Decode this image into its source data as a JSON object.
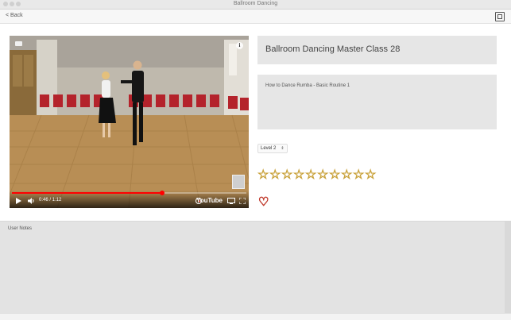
{
  "window": {
    "title": "Ballroom Dancing"
  },
  "toolbar": {
    "back_label": "< Back",
    "fullscreen_icon": "fullscreen-icon"
  },
  "video": {
    "time": "0:46 / 1:12",
    "progress": 0.64,
    "brand": "YouTube",
    "info_glyph": "i"
  },
  "lesson": {
    "title": "Ballroom Dancing Master Class 28",
    "description": "How to Dance Rumba - Basic Routine 1",
    "level": "Level 2",
    "rating": 0,
    "rating_max": 10,
    "favorite": false
  },
  "notes": {
    "label": "User Notes",
    "value": ""
  },
  "colors": {
    "star": "#c9a23b",
    "heart": "#c0392b",
    "progress": "#ff0000"
  }
}
